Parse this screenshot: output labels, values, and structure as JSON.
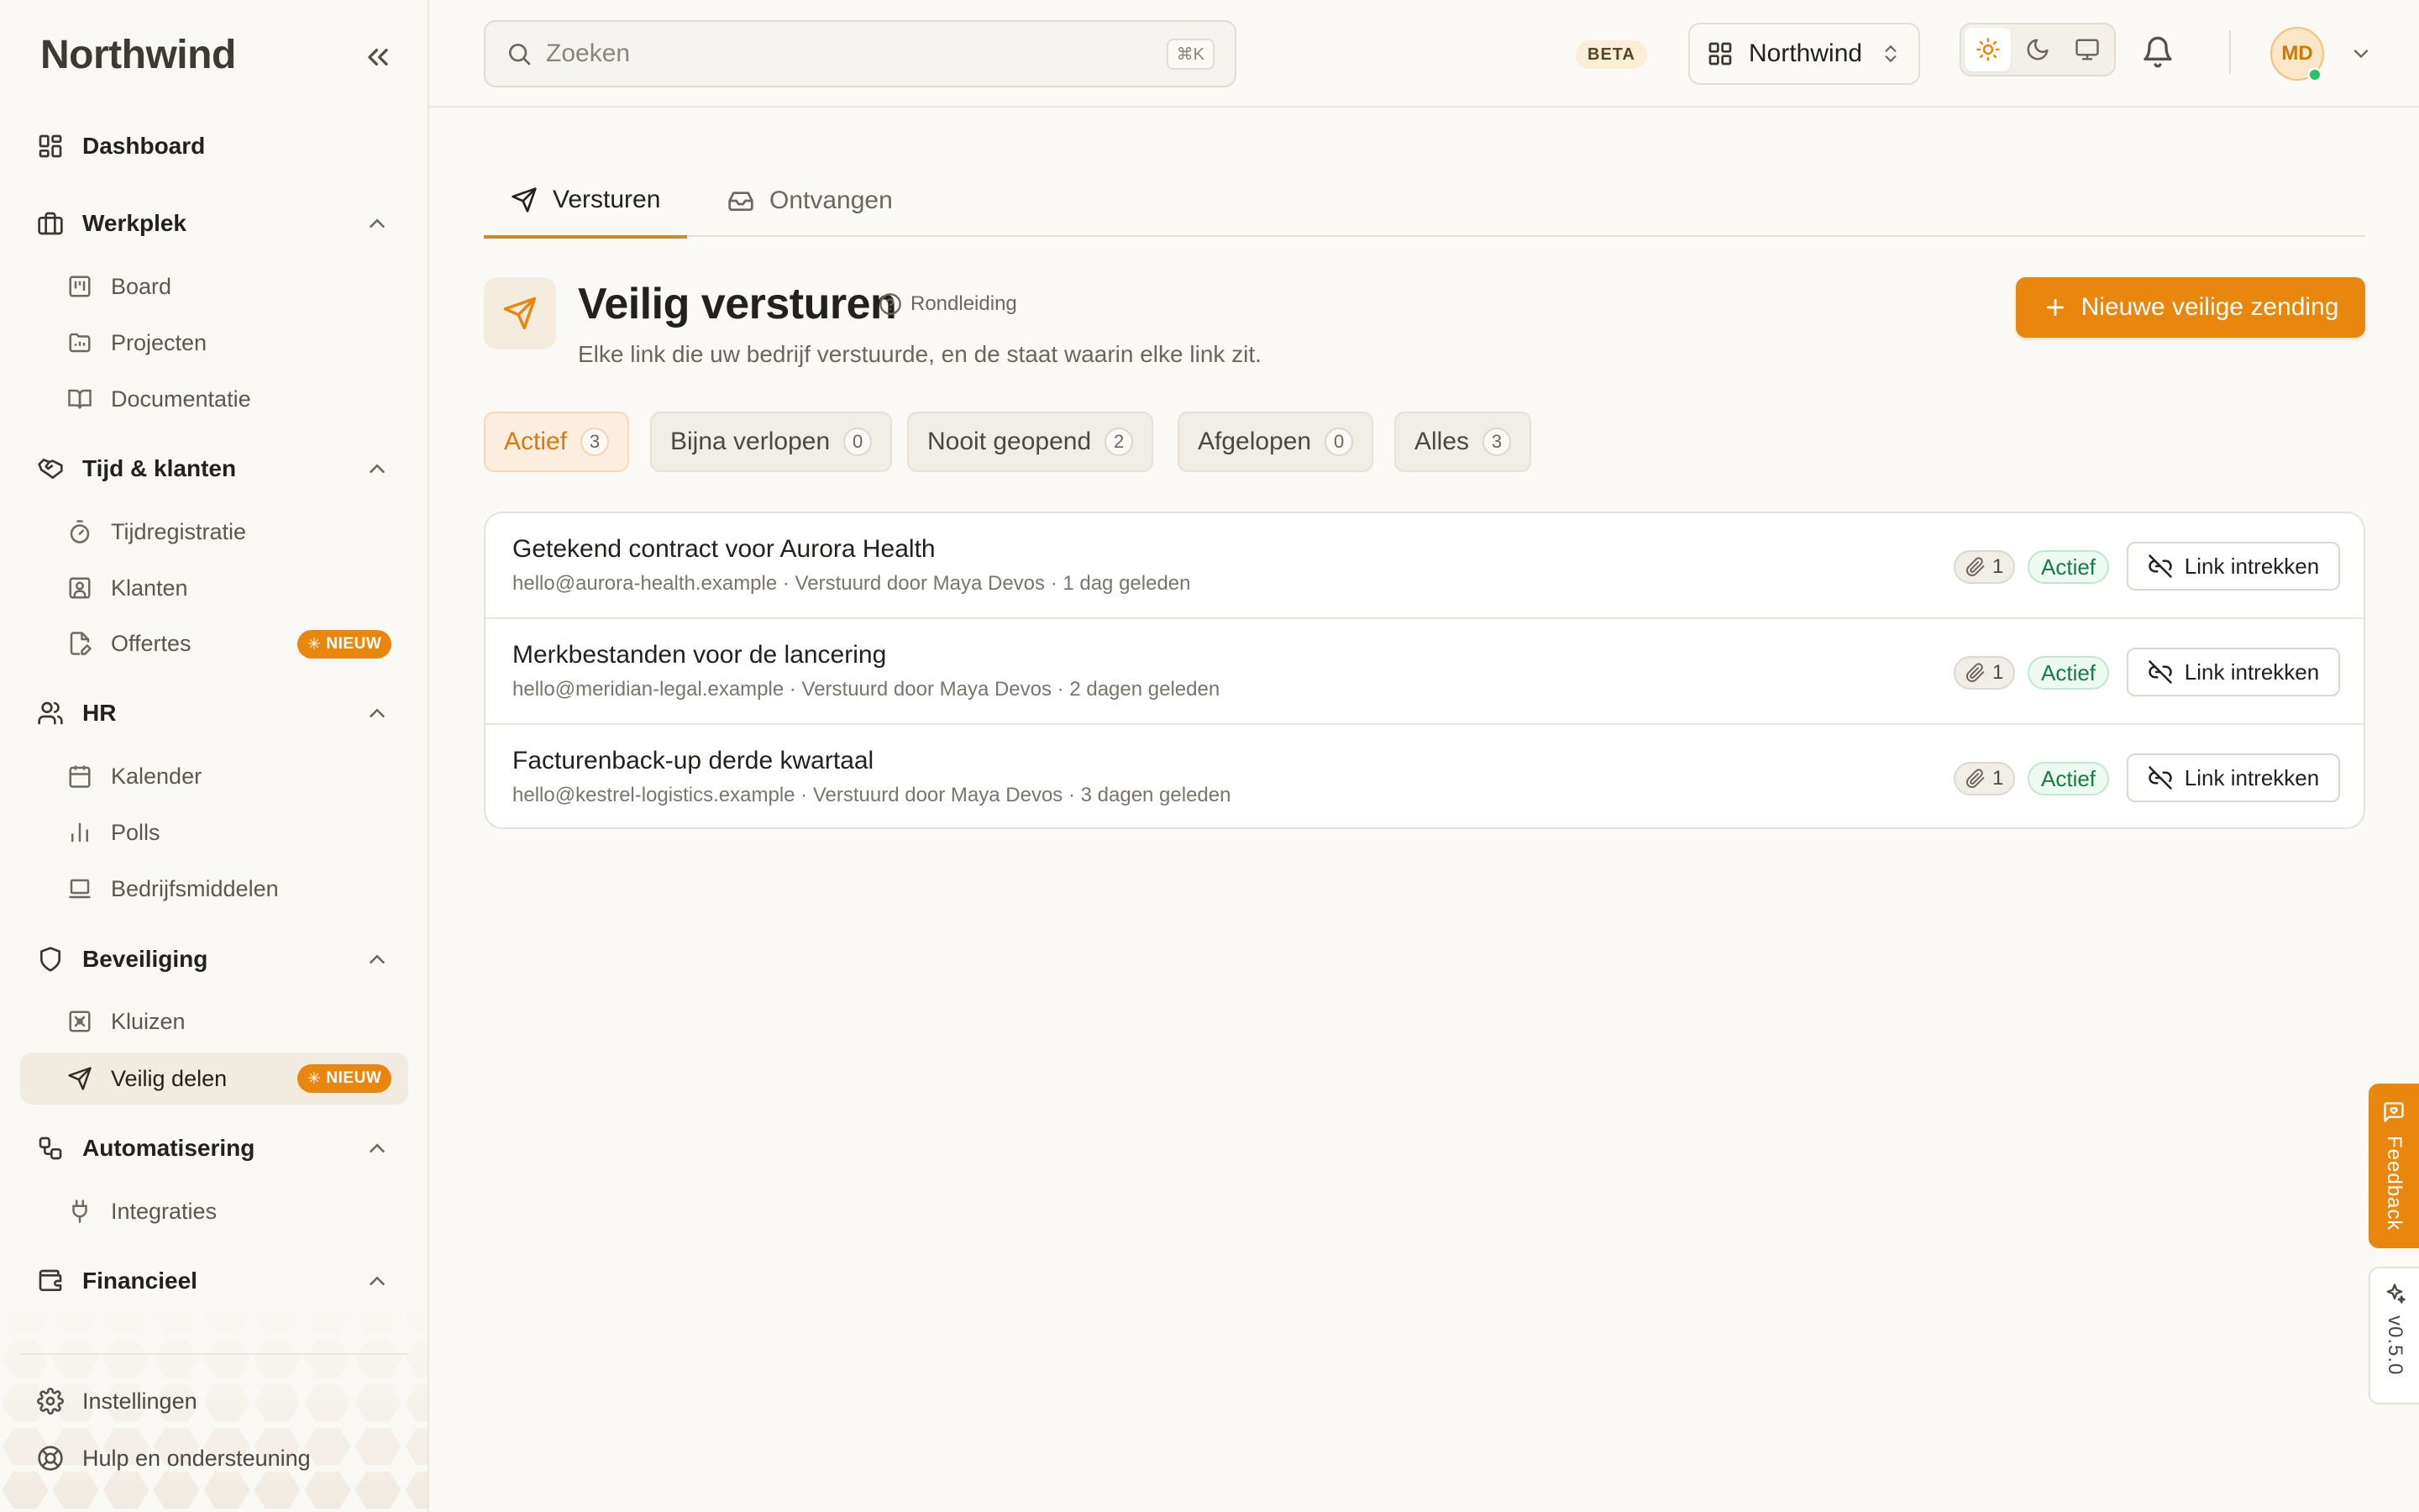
{
  "app": {
    "logo": "Northwind"
  },
  "sidebar": {
    "dashboard": "Dashboard",
    "sections": [
      {
        "label": "Werkplek",
        "items": [
          "Board",
          "Projecten",
          "Documentatie"
        ]
      },
      {
        "label": "Tijd & klanten",
        "items": [
          "Tijdregistratie",
          "Klanten",
          "Offertes"
        ]
      },
      {
        "label": "HR",
        "items": [
          "Kalender",
          "Polls",
          "Bedrijfsmiddelen"
        ]
      },
      {
        "label": "Beveiliging",
        "items": [
          "Kluizen",
          "Veilig delen"
        ]
      },
      {
        "label": "Automatisering",
        "items": [
          "Integraties"
        ]
      },
      {
        "label": "Financieel",
        "items": []
      }
    ],
    "new_badge": "NIEUW",
    "bottom": {
      "settings": "Instellingen",
      "help": "Hulp en ondersteuning"
    }
  },
  "header": {
    "search_placeholder": "Zoeken",
    "search_shortcut": "⌘K",
    "beta": "BETA",
    "workspace": "Northwind",
    "avatar_initials": "MD"
  },
  "tabs": [
    {
      "label": "Versturen"
    },
    {
      "label": "Ontvangen"
    }
  ],
  "page": {
    "title": "Veilig versturen",
    "tour": "Rondleiding",
    "subtitle": "Elke link die uw bedrijf verstuurde, en de staat waarin elke link zit.",
    "primary_action": "Nieuwe veilige zending"
  },
  "filters": [
    {
      "label": "Actief",
      "count": "3"
    },
    {
      "label": "Bijna verlopen",
      "count": "0"
    },
    {
      "label": "Nooit geopend",
      "count": "2"
    },
    {
      "label": "Afgelopen",
      "count": "0"
    },
    {
      "label": "Alles",
      "count": "3"
    }
  ],
  "shipments": [
    {
      "title": "Getekend contract voor Aurora Health",
      "meta": "hello@aurora-health.example · Verstuurd door Maya Devos · 1 dag geleden",
      "attachments": "1",
      "status": "Actief",
      "action": "Link intrekken"
    },
    {
      "title": "Merkbestanden voor de lancering",
      "meta": "hello@meridian-legal.example · Verstuurd door Maya Devos · 2 dagen geleden",
      "attachments": "1",
      "status": "Actief",
      "action": "Link intrekken"
    },
    {
      "title": "Facturenback-up derde kwartaal",
      "meta": "hello@kestrel-logistics.example · Verstuurd door Maya Devos · 3 dagen geleden",
      "attachments": "1",
      "status": "Actief",
      "action": "Link intrekken"
    }
  ],
  "edge": {
    "feedback": "Feedback",
    "version": "v0.5.0"
  },
  "colors": {
    "accent": "#e9860d",
    "status_active": "#167c43",
    "background": "#faf9f6"
  }
}
